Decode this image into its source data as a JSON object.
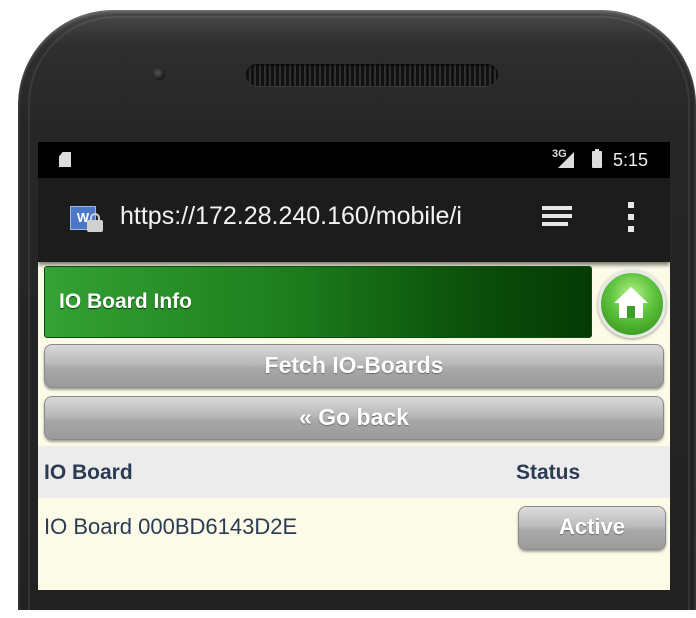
{
  "statusbar": {
    "network_type": "3G",
    "time": "5:15"
  },
  "browser": {
    "url": "https://172.28.240.160/mobile/i",
    "favicon_letter": "W"
  },
  "header": {
    "title": "IO Board Info",
    "accent_color": "#1d7d1d"
  },
  "buttons": {
    "fetch_label": "Fetch IO-Boards",
    "back_label": "« Go back"
  },
  "table": {
    "columns": [
      "IO Board",
      "Status"
    ],
    "rows": [
      {
        "board": "IO Board 000BD6143D2E",
        "status": "Active"
      }
    ]
  },
  "icons": {
    "home": "home-icon",
    "tabs": "tabs-icon",
    "menu": "overflow-menu-icon",
    "lock": "lock-icon",
    "signal": "signal-icon",
    "battery": "battery-icon",
    "sd": "sd-card-icon"
  }
}
